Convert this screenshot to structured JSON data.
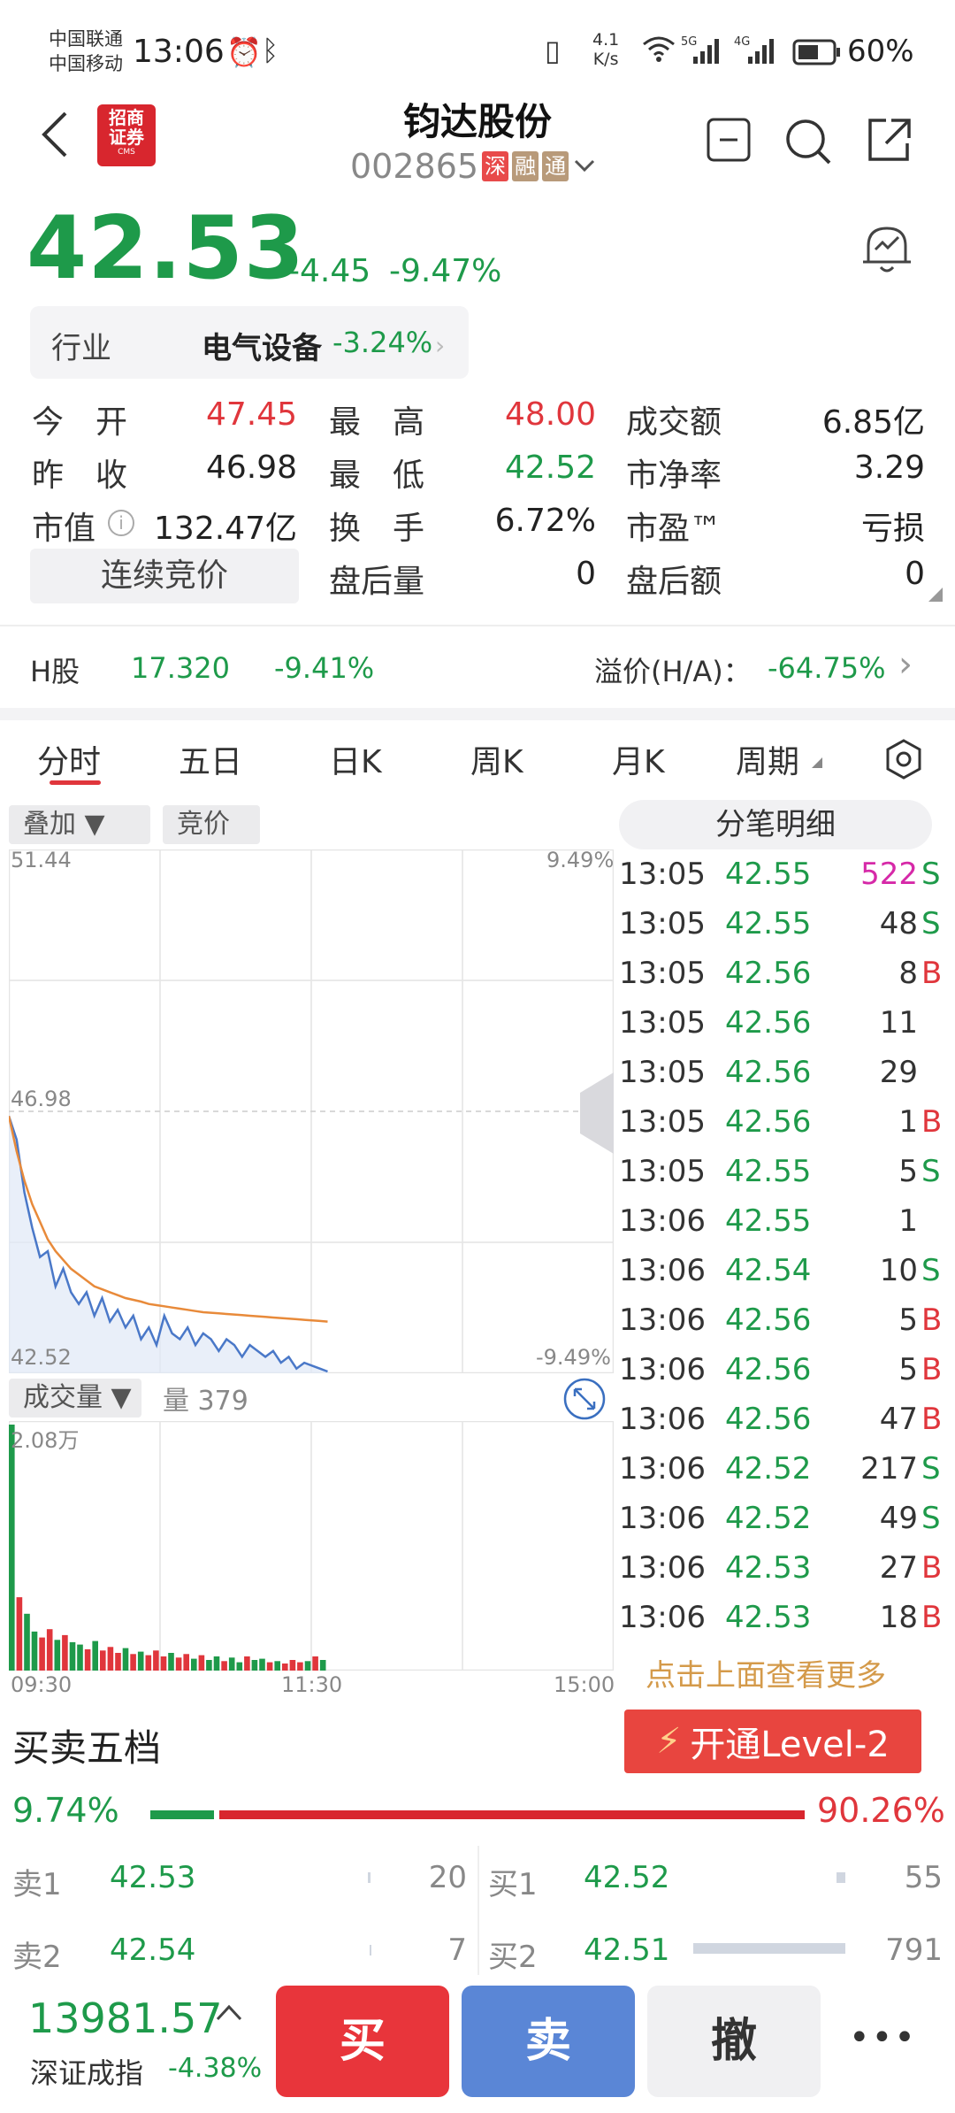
{
  "status_bar": {
    "carrier1": "中国联通",
    "carrier2": "中国移动",
    "time": "13:06",
    "net_speed_top": "4.1",
    "net_speed_bottom": "K/s",
    "signal1": "5G",
    "signal2": "4G",
    "battery": "60%"
  },
  "header": {
    "broker_logo_line1": "招商",
    "broker_logo_line2": "证券",
    "broker_logo_sub": "CMS",
    "stock_name": "钧达股份",
    "stock_code": "002865",
    "tags": [
      "深",
      "融",
      "通"
    ]
  },
  "quote": {
    "price": "42.53",
    "change": "-4.45",
    "change_pct": "-9.47%",
    "industry_label": "行业",
    "industry_name": "电气设备",
    "industry_pct": "-3.24%"
  },
  "stats": {
    "open_label": "今　开",
    "open": "47.45",
    "high_label": "最　高",
    "high": "48.00",
    "turnover_label": "成交额",
    "turnover": "6.85亿",
    "prev_label": "昨　收",
    "prev": "46.98",
    "low_label": "最　低",
    "low": "42.52",
    "pb_label": "市净率",
    "pb": "3.29",
    "mcap_label": "市值",
    "mcap": "132.47亿",
    "turn_label": "换　手",
    "turn": "6.72%",
    "pe_label": "市盈™",
    "pe": "亏损",
    "auction_btn": "连续竞价",
    "after_vol_label": "盘后量",
    "after_vol": "0",
    "after_amt_label": "盘后额",
    "after_amt": "0"
  },
  "h_share": {
    "label": "H股",
    "price": "17.320",
    "pct": "-9.41%",
    "premium_label": "溢价(H/A)：",
    "premium": "-64.75%"
  },
  "tabs": [
    "分时",
    "五日",
    "日K",
    "周K",
    "月K",
    "周期"
  ],
  "chart_controls": {
    "overlay": "叠加 ▼",
    "auction": "竞价",
    "tick_detail": "分笔明细",
    "volume_btn": "成交量 ▼",
    "volume_label": "量 379"
  },
  "chart_data": {
    "type": "line",
    "price_axis": {
      "top": "51.44",
      "mid": "46.98",
      "bottom": "42.52",
      "pct_top": "9.49%",
      "pct_bottom": "-9.49%"
    },
    "vol_axis_top": "2.08万",
    "time_labels": [
      "09:30",
      "11:30",
      "15:00"
    ],
    "ylim": [
      42.52,
      51.44
    ],
    "price_series": [
      46.9,
      46.5,
      45.6,
      45.0,
      44.5,
      44.6,
      44.0,
      44.3,
      43.9,
      43.7,
      43.9,
      43.5,
      43.8,
      43.4,
      43.6,
      43.3,
      43.5,
      43.1,
      43.3,
      43.0,
      43.5,
      43.2,
      43.1,
      43.3,
      43.0,
      43.2,
      43.1,
      42.9,
      43.1,
      43.0,
      42.8,
      43.0,
      42.9,
      42.8,
      42.9,
      42.7,
      42.8,
      42.6,
      42.7,
      42.65,
      42.6,
      42.55
    ],
    "avg_series": [
      46.9,
      46.3,
      45.8,
      45.4,
      45.1,
      44.8,
      44.6,
      44.45,
      44.3,
      44.2,
      44.1,
      44.0,
      43.95,
      43.9,
      43.85,
      43.8,
      43.77,
      43.74,
      43.7,
      43.68,
      43.66,
      43.64,
      43.62,
      43.6,
      43.58,
      43.56,
      43.55,
      43.54,
      43.53,
      43.52,
      43.51,
      43.5,
      43.49,
      43.48,
      43.47,
      43.46,
      43.45,
      43.44,
      43.43,
      43.42,
      43.41,
      43.4
    ],
    "volume_series": [
      20800,
      6200,
      4800,
      3300,
      2800,
      3500,
      2600,
      3000,
      2400,
      2200,
      1800,
      2500,
      1700,
      2000,
      1500,
      1900,
      1400,
      1600,
      1300,
      1700,
      1200,
      1500,
      1100,
      1400,
      1000,
      1300,
      900,
      1200,
      800,
      1100,
      700,
      1200,
      900,
      1000,
      700,
      800,
      600,
      900,
      700,
      800,
      1200,
      900
    ],
    "volume_ylim": [
      0,
      20800
    ]
  },
  "ticks": [
    {
      "time": "13:05",
      "price": "42.55",
      "vol": "522",
      "bs": "S",
      "mag": true
    },
    {
      "time": "13:05",
      "price": "42.55",
      "vol": "48",
      "bs": "S"
    },
    {
      "time": "13:05",
      "price": "42.56",
      "vol": "8",
      "bs": "B"
    },
    {
      "time": "13:05",
      "price": "42.56",
      "vol": "11",
      "bs": ""
    },
    {
      "time": "13:05",
      "price": "42.56",
      "vol": "29",
      "bs": ""
    },
    {
      "time": "13:05",
      "price": "42.56",
      "vol": "1",
      "bs": "B"
    },
    {
      "time": "13:05",
      "price": "42.55",
      "vol": "5",
      "bs": "S"
    },
    {
      "time": "13:06",
      "price": "42.55",
      "vol": "1",
      "bs": ""
    },
    {
      "time": "13:06",
      "price": "42.54",
      "vol": "10",
      "bs": "S"
    },
    {
      "time": "13:06",
      "price": "42.56",
      "vol": "5",
      "bs": "B"
    },
    {
      "time": "13:06",
      "price": "42.56",
      "vol": "5",
      "bs": "B"
    },
    {
      "time": "13:06",
      "price": "42.56",
      "vol": "47",
      "bs": "B"
    },
    {
      "time": "13:06",
      "price": "42.52",
      "vol": "217",
      "bs": "S"
    },
    {
      "time": "13:06",
      "price": "42.52",
      "vol": "49",
      "bs": "S"
    },
    {
      "time": "13:06",
      "price": "42.53",
      "vol": "27",
      "bs": "B"
    },
    {
      "time": "13:06",
      "price": "42.53",
      "vol": "18",
      "bs": "B"
    }
  ],
  "more_link": "点击上面查看更多",
  "order_book": {
    "title": "买卖五档",
    "level2_btn": "开通Level-2",
    "buy_pct": "9.74%",
    "sell_pct": "90.26%",
    "buy_ratio": 0.0974,
    "rows": [
      {
        "sell_label": "卖1",
        "sell_price": "42.53",
        "sell_vol": "20",
        "buy_label": "买1",
        "buy_price": "42.52",
        "buy_vol": "55"
      },
      {
        "sell_label": "卖2",
        "sell_price": "42.54",
        "sell_vol": "7",
        "buy_label": "买2",
        "buy_price": "42.51",
        "buy_vol": "791"
      }
    ]
  },
  "bottom": {
    "index_value": "13981.57",
    "index_name": "深证成指",
    "index_pct": "-4.38%",
    "buy": "买",
    "sell": "卖",
    "cancel": "撤",
    "more": "•••"
  },
  "colors": {
    "up": "#e0363c",
    "down": "#1e9a4a",
    "price_line": "#4a78c8",
    "avg_line": "#e88a3a",
    "buy_btn": "#e8353b",
    "sell_btn": "#5a86d6"
  }
}
